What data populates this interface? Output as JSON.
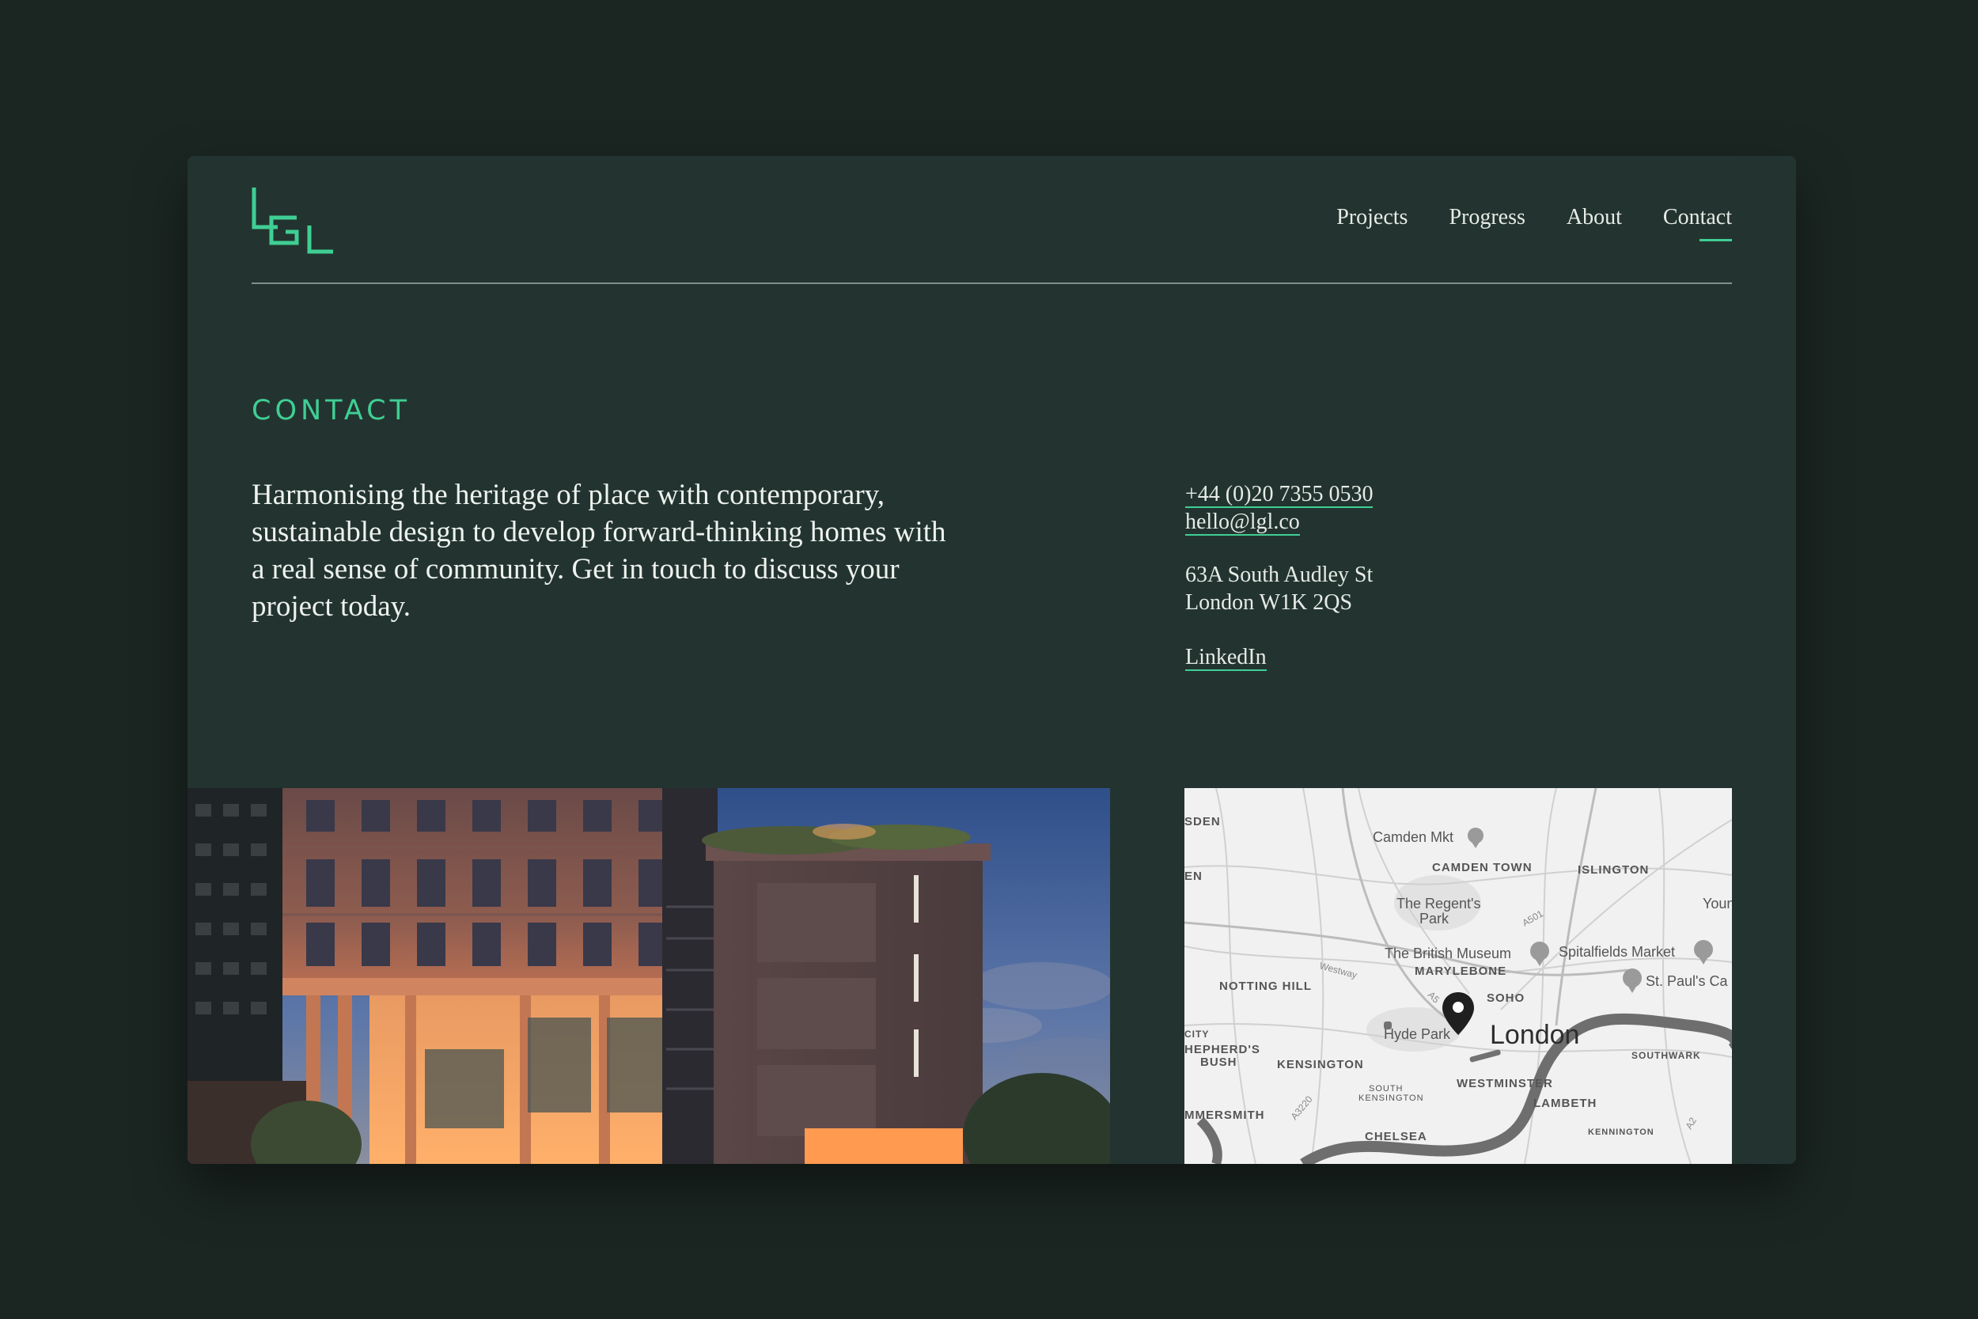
{
  "brand": {
    "logo_text": "LGL",
    "accent_color": "#3fcf94"
  },
  "nav": {
    "items": [
      {
        "label": "Projects"
      },
      {
        "label": "Progress"
      },
      {
        "label": "About"
      },
      {
        "label": "Contact",
        "active": true
      }
    ]
  },
  "contact": {
    "section_title": "CONTACT",
    "intro": "Harmonising the heritage of place with contemporary, sustainable design to develop forward-thinking homes with a real sense of community. Get in touch to discuss your project today.",
    "phone": "+44 (0)20 7355 0530",
    "email": "hello@lgl.co",
    "address_line1": "63A South Audley St",
    "address_line2": "London W1K 2QS",
    "linkedin": "LinkedIn"
  },
  "map": {
    "labels": {
      "sden": "SDEN",
      "en": "EN",
      "camden_mkt": "Camden Mkt",
      "camden_town": "CAMDEN TOWN",
      "islington": "ISLINGTON",
      "regents_park_1": "The Regent's",
      "regents_park_2": "Park",
      "young": "Young V",
      "british_museum": "The British Museum",
      "spitalfields": "Spitalfields Market",
      "marylebone": "MARYLEBONE",
      "notting_hill": "NOTTING HILL",
      "st_pauls": "St. Paul's Ca",
      "westway": "Westway",
      "soho": "SOHO",
      "city": "CITY",
      "shepherds_1": "HEPHERD'S",
      "shepherds_2": "BUSH",
      "hyde_park": "Hyde Park",
      "london": "London",
      "southwark": "SOUTHWARK",
      "kensington": "KENSINGTON",
      "south_kensington_1": "SOUTH",
      "south_kensington_2": "KENSINGTON",
      "westminster": "WESTMINSTER",
      "lambeth": "LAMBETH",
      "hammersmith": "MMERSMITH",
      "chelsea": "CHELSEA",
      "kennington": "KENNINGTON",
      "a501": "A501",
      "a5": "A5",
      "a3220": "A3220",
      "a2": "A2"
    }
  }
}
